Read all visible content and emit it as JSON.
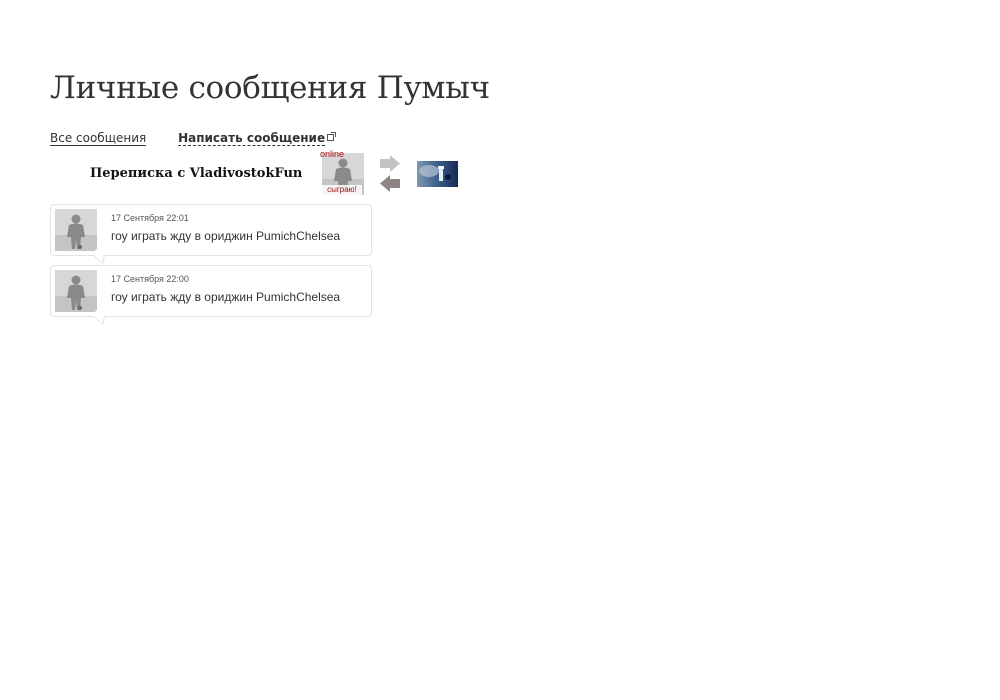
{
  "page": {
    "title": "Личные сообщения Пумыч"
  },
  "nav": {
    "all_messages": "Все сообщения",
    "write_message": "Написать сообщение"
  },
  "thread": {
    "label": "Переписка с VladivostokFun",
    "partner": {
      "status": "online",
      "badge": "сыграю!"
    },
    "icons": {
      "next": "arrow-right-icon",
      "prev": "arrow-left-icon"
    }
  },
  "messages": [
    {
      "date": "17 Сентября 22:01",
      "text": "гоу играть жду в ориджин PumichChelsea"
    },
    {
      "date": "17 Сентября 22:00",
      "text": "гоу играть жду в ориджин PumichChelsea"
    }
  ],
  "colors": {
    "accent": "#a11111",
    "text": "#333333",
    "border": "#e2e2e2"
  }
}
